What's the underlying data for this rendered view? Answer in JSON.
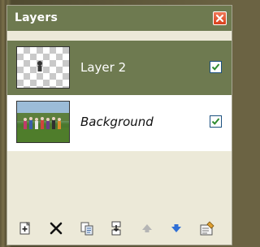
{
  "panel": {
    "title": "Layers",
    "close_icon": "close-icon"
  },
  "layers": [
    {
      "name": "Layer 2",
      "visible": true,
      "selected": true,
      "thumbnail": "transparent-checker"
    },
    {
      "name": "Background",
      "visible": true,
      "selected": false,
      "thumbnail": "group-photo"
    }
  ],
  "toolbar": {
    "buttons": [
      {
        "icon": "add-layer-icon",
        "enabled": true
      },
      {
        "icon": "delete-layer-icon",
        "enabled": true
      },
      {
        "icon": "duplicate-layer-icon",
        "enabled": true
      },
      {
        "icon": "merge-layer-down-icon",
        "enabled": true
      },
      {
        "icon": "move-layer-up-icon",
        "enabled": false
      },
      {
        "icon": "move-layer-down-icon",
        "enabled": true
      },
      {
        "icon": "layer-properties-icon",
        "enabled": true
      }
    ]
  },
  "colors": {
    "titlebar": "#6e7a50",
    "selected_row": "#6e7a50",
    "panel_bg": "#ece9d8",
    "close_red": "#d8401c",
    "check_green": "#2e8b2e"
  }
}
